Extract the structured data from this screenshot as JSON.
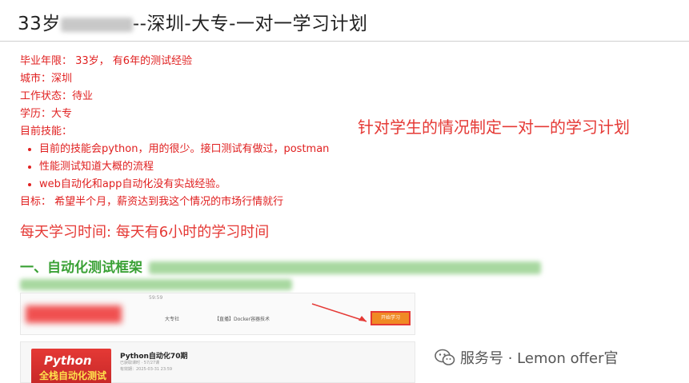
{
  "header": {
    "title_prefix": "33岁",
    "title_suffix": "--深圳-大专-一对一学习计划"
  },
  "profile": {
    "grad_years": "毕业年限： 33岁， 有6年的测试经验",
    "city": "城市：深圳",
    "work_status": "工作状态：待业",
    "education": "学历：大专",
    "skills_label": "目前技能：",
    "skills": [
      "目前的技能会python，用的很少。接口测试有做过，postman",
      "性能测试知道大概的流程",
      "web自动化和app自动化没有实战经验。"
    ],
    "goal": "目标： 希望半个月，薪资达到我这个情况的市场行情就行"
  },
  "annotation": "针对学生的情况制定一对一的学习计划",
  "study_time": "每天学习时间:  每天有6小时的学习时间",
  "section1": {
    "title": "一、自动化测试框架"
  },
  "screenshot_top": {
    "time": "59:59",
    "nav_item_1": "大专社",
    "nav_item_2": "【直播】Docker容器技术",
    "button": "开始学习",
    "colors": {
      "button": "#f08a24",
      "highlight": "#e53935"
    }
  },
  "screenshot_course": {
    "cover_line1": "Python",
    "cover_line2": "全栈自动化测试",
    "course_title": "Python自动化70期",
    "meta_1": "已获取课时 · 57/27课",
    "meta_2": "有效期：2025-03-31 23:59"
  },
  "watermark": {
    "text": "服务号 · Lemon offer官",
    "icon": "wechat-icon"
  }
}
